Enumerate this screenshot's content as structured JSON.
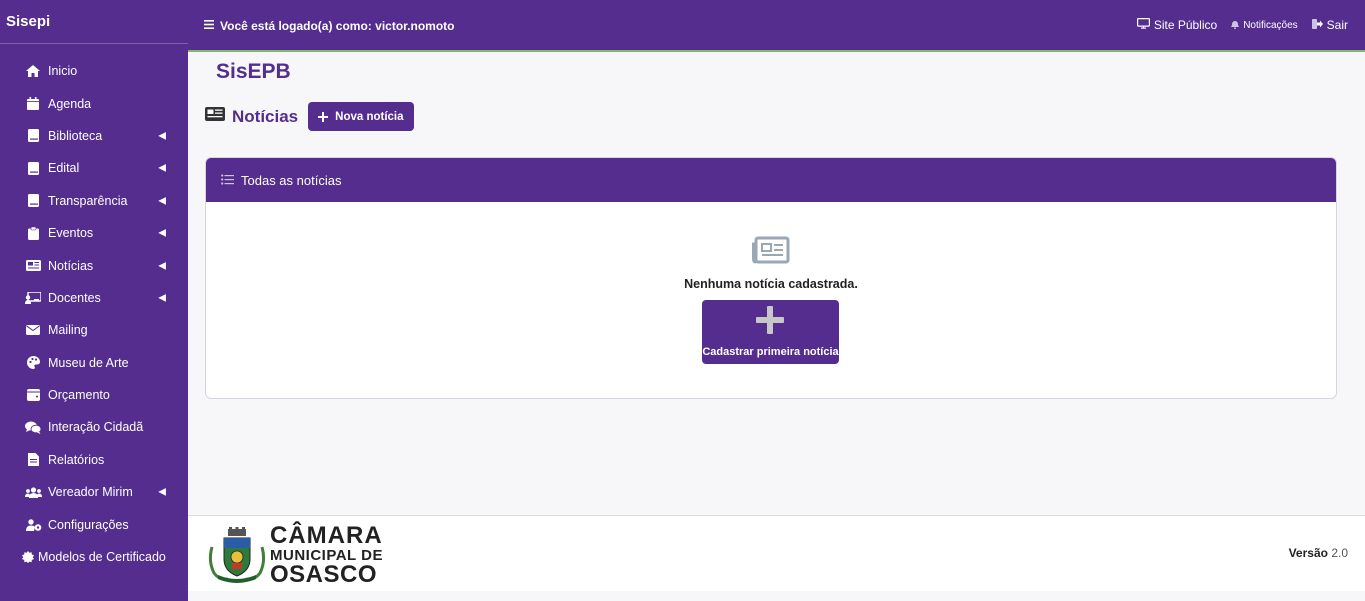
{
  "sidebar": {
    "brand": "Sisepi",
    "items": [
      {
        "label": "Inicio",
        "icon": "home-icon",
        "expandable": false
      },
      {
        "label": "Agenda",
        "icon": "calendar-icon",
        "expandable": false
      },
      {
        "label": "Biblioteca",
        "icon": "book-icon",
        "expandable": true
      },
      {
        "label": "Edital",
        "icon": "book-icon",
        "expandable": true
      },
      {
        "label": "Transparência",
        "icon": "book-icon",
        "expandable": true
      },
      {
        "label": "Eventos",
        "icon": "clipboard-icon",
        "expandable": true
      },
      {
        "label": "Notícias",
        "icon": "newspaper-icon",
        "expandable": true
      },
      {
        "label": "Docentes",
        "icon": "teacher-icon",
        "expandable": true
      },
      {
        "label": "Mailing",
        "icon": "envelope-icon",
        "expandable": false
      },
      {
        "label": "Museu de Arte",
        "icon": "palette-icon",
        "expandable": false
      },
      {
        "label": "Orçamento",
        "icon": "wallet-icon",
        "expandable": false
      },
      {
        "label": "Interação Cidadã",
        "icon": "comments-icon",
        "expandable": false
      },
      {
        "label": "Relatórios",
        "icon": "file-icon",
        "expandable": false
      },
      {
        "label": "Vereador Mirim",
        "icon": "users-icon",
        "expandable": true
      },
      {
        "label": "Configurações",
        "icon": "users-cog-icon",
        "expandable": false
      },
      {
        "label": "Modelos de Certificado",
        "icon": "certificate-icon",
        "expandable": false
      }
    ]
  },
  "topbar": {
    "user_text": "Você está logado(a) como: victor.nomoto",
    "site_publico": "Site Público",
    "notificacoes": "Notificações",
    "sair": "Sair"
  },
  "main": {
    "app_title": "SisEPB",
    "section_title": "Notícias",
    "new_button": "Nova notícia",
    "card_title": "Todas as notícias",
    "empty_message": "Nenhuma notícia cadastrada.",
    "first_button": "Cadastrar primeira notícia"
  },
  "footer": {
    "logo_line1": "CÂMARA",
    "logo_line2": "MUNICIPAL DE",
    "logo_line3": "OSASCO",
    "version_label": "Versão",
    "version_value": "2.0"
  },
  "colors": {
    "primary": "#542d8e",
    "accent_line": "#7fb86a",
    "background": "#f7f7fa"
  }
}
